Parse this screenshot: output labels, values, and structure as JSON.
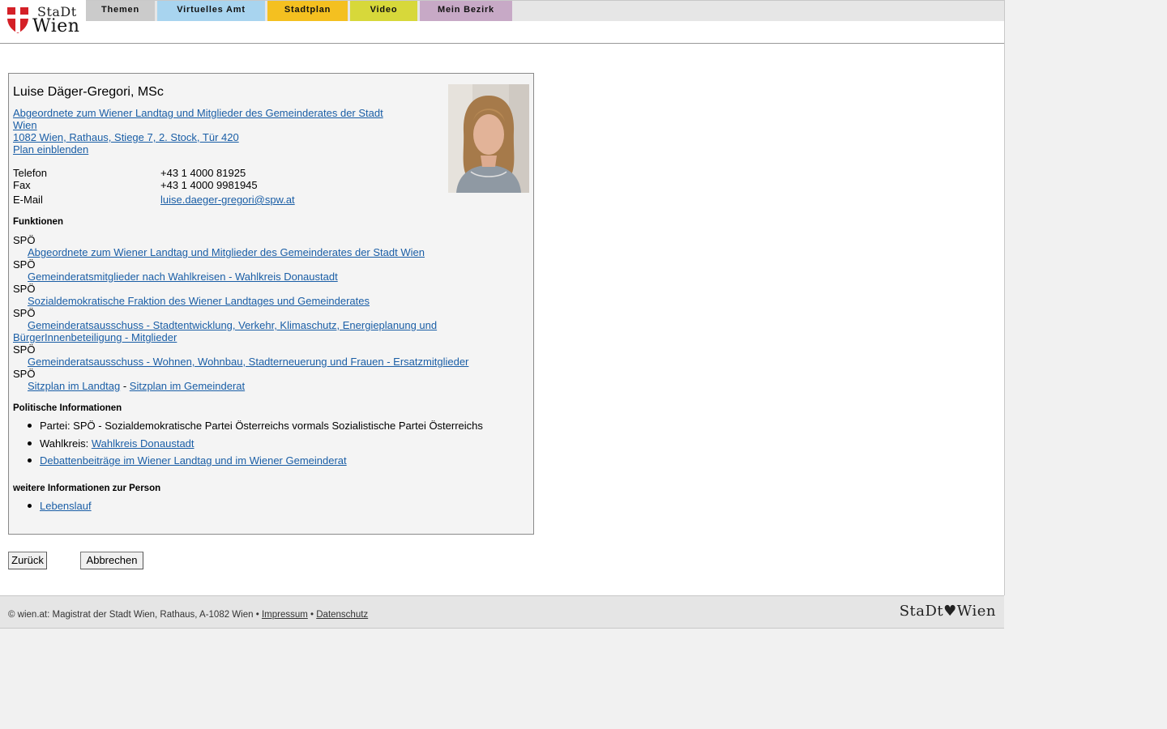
{
  "header": {
    "logo": {
      "stadt": "StaDt",
      "wien": "Wien"
    },
    "nav": [
      {
        "label": "Themen",
        "color": "#cbcbcb"
      },
      {
        "label": "Virtuelles Amt",
        "color": "#a8d4ef"
      },
      {
        "label": "Stadtplan",
        "color": "#f4c020"
      },
      {
        "label": "Video",
        "color": "#d7d83a"
      },
      {
        "label": "Mein Bezirk",
        "color": "#c7a9c6"
      }
    ]
  },
  "person": {
    "name": "Luise Däger-Gregori, MSc",
    "role_line1": "Abgeordnete zum Wiener Landtag und Mitglieder des Gemeinderates der Stadt",
    "role_line2": "Wien",
    "address": "1082 Wien, Rathaus, Stiege 7, 2. Stock, Tür 420",
    "plan_link": "Plan einblenden",
    "phone_label": "Telefon",
    "phone": "+43 1 4000 81925",
    "fax_label": "Fax",
    "fax": "+43 1 4000 9981945",
    "email_label": "E-Mail",
    "email": "luise.daeger-gregori@spw.at"
  },
  "functions": {
    "heading": "Funktionen",
    "party": "SPÖ",
    "items": [
      "Abgeordnete zum Wiener Landtag und Mitglieder des Gemeinderates der Stadt Wien",
      "Gemeinderatsmitglieder nach Wahlkreisen - Wahlkreis Donaustadt",
      "Sozialdemokratische Fraktion des Wiener Landtages und Gemeinderates",
      "Gemeinderatsausschuss - Stadtentwicklung, Verkehr, Klimaschutz, Energieplanung und",
      "BürgerInnenbeteiligung - Mitglieder",
      "Gemeinderatsausschuss - Wohnen, Wohnbau, Stadterneuerung und Frauen - Ersatzmitglieder"
    ],
    "sitzplan_landtag": "Sitzplan im Landtag",
    "separator": "-",
    "sitzplan_gemeinderat": "Sitzplan im Gemeinderat"
  },
  "political": {
    "heading": "Politische Informationen",
    "partei": "Partei: SPÖ - Sozialdemokratische Partei Österreichs vormals Sozialistische Partei Österreichs",
    "wahlkreis_label": "Wahlkreis:",
    "wahlkreis_link": "Wahlkreis Donaustadt",
    "debatten": "Debattenbeiträge im Wiener Landtag und im Wiener Gemeinderat"
  },
  "more": {
    "heading": "weitere Informationen zur Person",
    "lebenslauf": "Lebenslauf"
  },
  "buttons": {
    "back": "Zurück",
    "cancel": "Abbrechen"
  },
  "footer": {
    "copyright": "© wien.at: Magistrat der Stadt Wien, Rathaus, A-1082 Wien •",
    "impressum": "Impressum",
    "bullet": "•",
    "datenschutz": "Datenschutz",
    "logo": "StaDt♥Wien"
  }
}
